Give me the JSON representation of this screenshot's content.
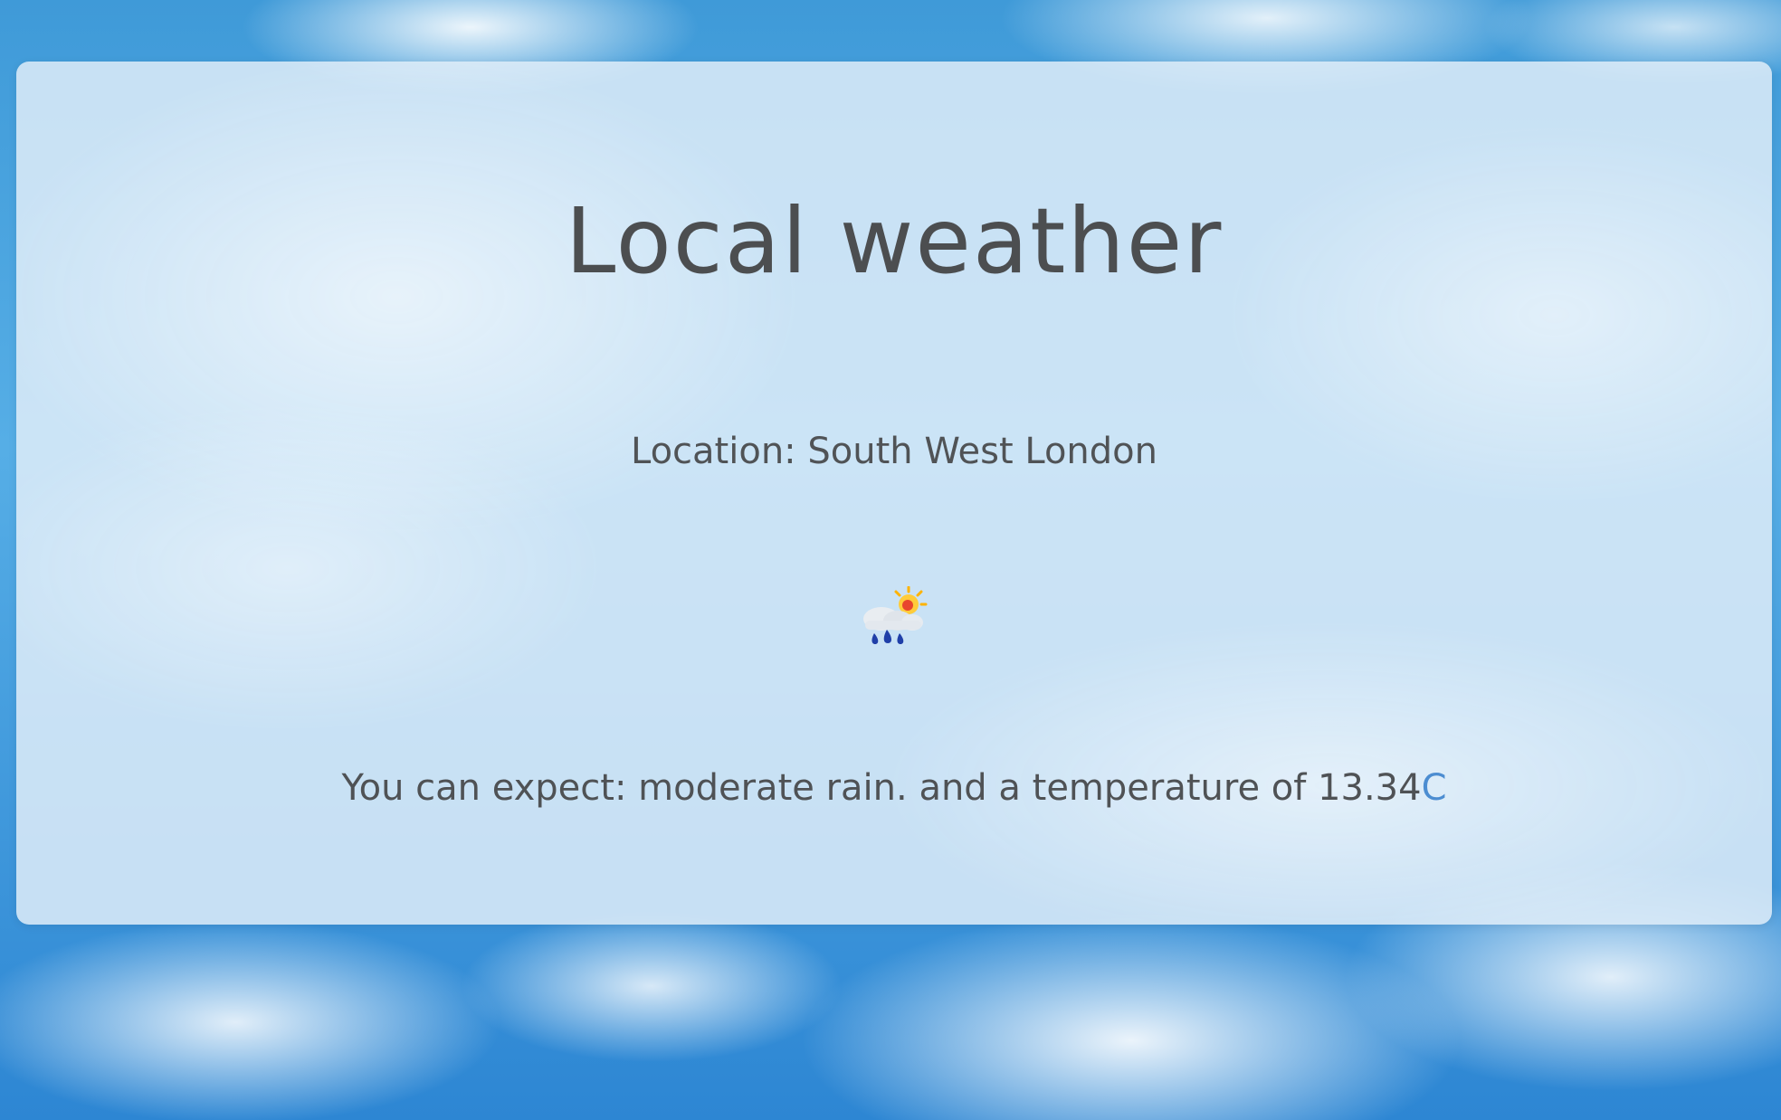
{
  "page": {
    "title": "Local weather"
  },
  "location": {
    "label": "Location:",
    "value": "South West London"
  },
  "weather": {
    "icon": "rain-with-sun-icon",
    "forecast_prefix": "You can expect:",
    "condition": "moderate rain.",
    "temperature_text": "and a temperature of",
    "temperature": "13.34",
    "unit": "C"
  },
  "colors": {
    "text": "#4d4f52",
    "unit_link": "#4c8dd1",
    "card_bg": "#deecf8",
    "sky": "#3f9ad8"
  }
}
